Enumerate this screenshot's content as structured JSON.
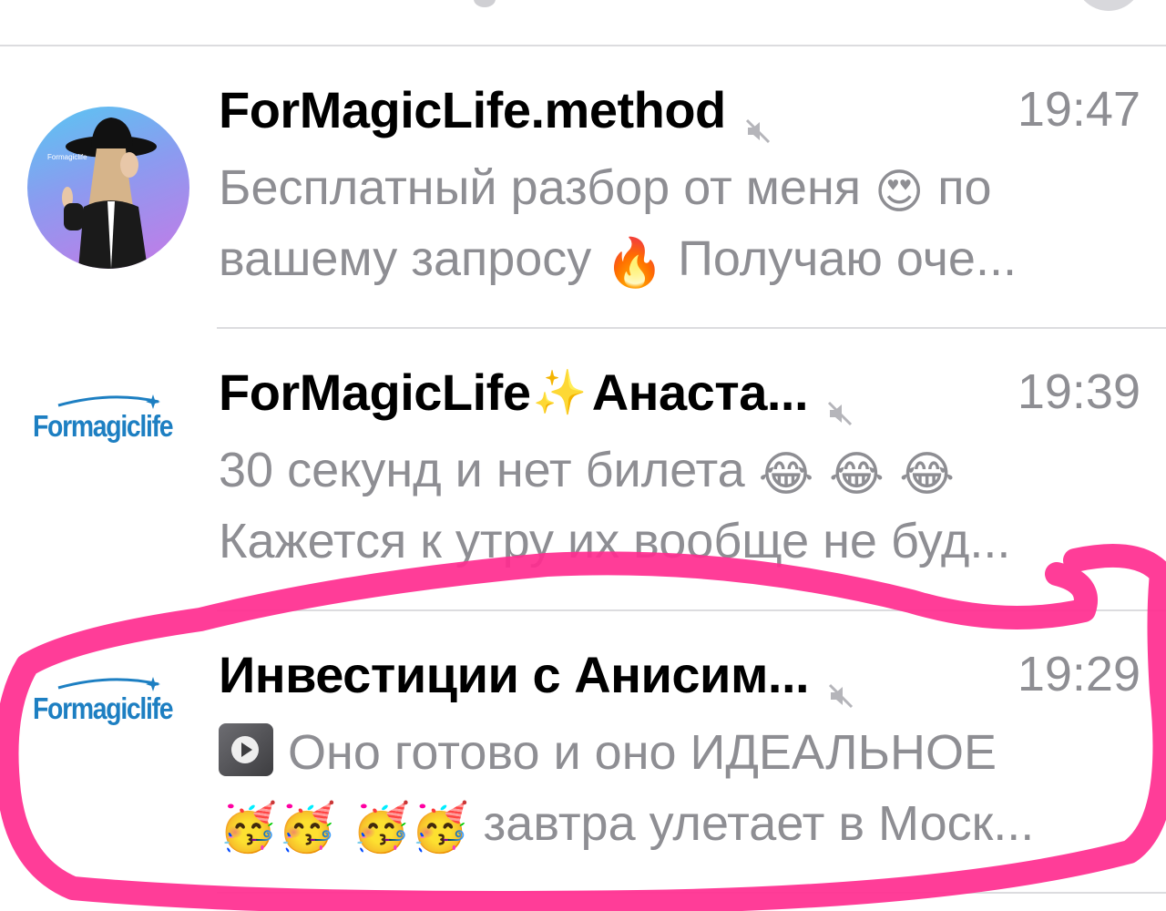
{
  "colors": {
    "title": "#000000",
    "secondary_text": "#8e8e93",
    "divider": "#dcdcdf",
    "brand_blue": "#1d7fc2",
    "highlight_marker": "#ff2d8f"
  },
  "chats": [
    {
      "title": "ForMagicLife.method",
      "muted": true,
      "time": "19:47",
      "avatar": "photo-woman-in-hat",
      "preview_line_1": "Бесплатный разбор от меня",
      "preview_line_1_emoji": "😍",
      "preview_line_1_tail": "по",
      "preview_line_2": "вашему запросу",
      "preview_line_2_emoji": "🔥",
      "preview_line_2_tail": "Получаю оче..."
    },
    {
      "title": "ForMagicLife",
      "title_emoji": "✨",
      "title_tail": "Анаста...",
      "muted": true,
      "time": "19:39",
      "avatar": "formagiclife-logo",
      "avatar_text": "Formagiclife",
      "preview_line_1": "30 секунд и нет билета",
      "preview_line_1_emoji": "😂 😂 😂",
      "preview_line_2": "Кажется к утру их вообще не буд..."
    },
    {
      "title": "Инвестиции с Анисим...",
      "muted": true,
      "time": "19:29",
      "avatar": "formagiclife-logo",
      "avatar_text": "Formagiclife",
      "preview_line_1": "Оно готово и оно ИДЕАЛЬНОЕ",
      "preview_line_2_emoji": "🥳🥳 🥳🥳",
      "preview_line_2": "завтра улетает в Моск..."
    }
  ]
}
